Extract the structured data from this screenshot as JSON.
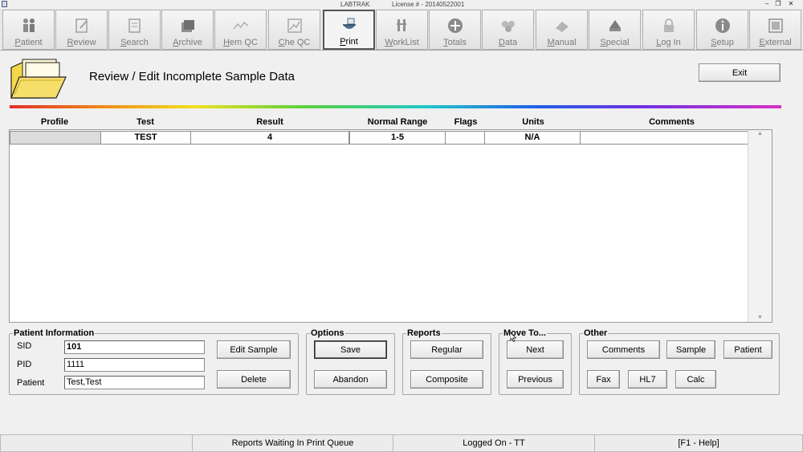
{
  "window": {
    "title": "LABTRAK",
    "license": "License # - 20140522001",
    "minimize": "–",
    "restore": "❐",
    "close": "✕"
  },
  "toolbar": {
    "buttons": [
      {
        "label": "Patient",
        "icon": "patient-icon",
        "enabled": true
      },
      {
        "label": "Review",
        "icon": "review-icon",
        "enabled": true
      },
      {
        "label": "Search",
        "icon": "search-icon",
        "enabled": true
      },
      {
        "label": "Archive",
        "icon": "archive-icon",
        "enabled": true
      },
      {
        "label": "Hem QC",
        "icon": "hem-qc-icon",
        "enabled": true
      },
      {
        "label": "Che QC",
        "icon": "che-qc-icon",
        "enabled": true
      },
      {
        "label": "Print",
        "icon": "print-icon",
        "enabled": true
      },
      {
        "label": "WorkList",
        "icon": "worklist-icon",
        "enabled": true
      },
      {
        "label": "Totals",
        "icon": "totals-icon",
        "enabled": true
      },
      {
        "label": "Data",
        "icon": "data-icon",
        "enabled": true
      },
      {
        "label": "Manual",
        "icon": "manual-icon",
        "enabled": true
      },
      {
        "label": "Special",
        "icon": "special-icon",
        "enabled": true
      },
      {
        "label": "Log In",
        "icon": "lock-icon",
        "enabled": true
      },
      {
        "label": "Setup",
        "icon": "info-icon",
        "enabled": true
      },
      {
        "label": "External",
        "icon": "external-icon",
        "enabled": true
      }
    ]
  },
  "header": {
    "title": "Review / Edit Incomplete Sample Data",
    "exit_label": "Exit"
  },
  "table": {
    "columns": [
      "Profile",
      "Test",
      "Result",
      "Normal Range",
      "Flags",
      "Units",
      "Comments"
    ],
    "rows": [
      {
        "profile": "",
        "test": "TEST",
        "result": "4",
        "normal_range": "1-5",
        "flags": "",
        "units": "N/A",
        "comments": ""
      }
    ]
  },
  "patient_info": {
    "title": "Patient Information",
    "sid_label": "SID",
    "sid_value": "101",
    "pid_label": "PID",
    "pid_value": "1111",
    "patient_label": "Patient",
    "patient_value": "Test,Test",
    "edit_sample_label": "Edit Sample",
    "delete_label": "Delete"
  },
  "options": {
    "title": "Options",
    "save_label": "Save",
    "abandon_label": "Abandon"
  },
  "reports": {
    "title": "Reports",
    "regular_label": "Regular",
    "composite_label": "Composite"
  },
  "move_to": {
    "title": "Move To...",
    "next_label": "Next",
    "previous_label": "Previous"
  },
  "other": {
    "title": "Other",
    "comments_label": "Comments",
    "sample_label": "Sample",
    "patient_label": "Patient",
    "fax_label": "Fax",
    "hl7_label": "HL7",
    "calc_label": "Calc"
  },
  "status": {
    "print_queue": "Reports Waiting In Print Queue",
    "logged_on": "Logged On - TT",
    "help": "[F1 - Help]"
  }
}
